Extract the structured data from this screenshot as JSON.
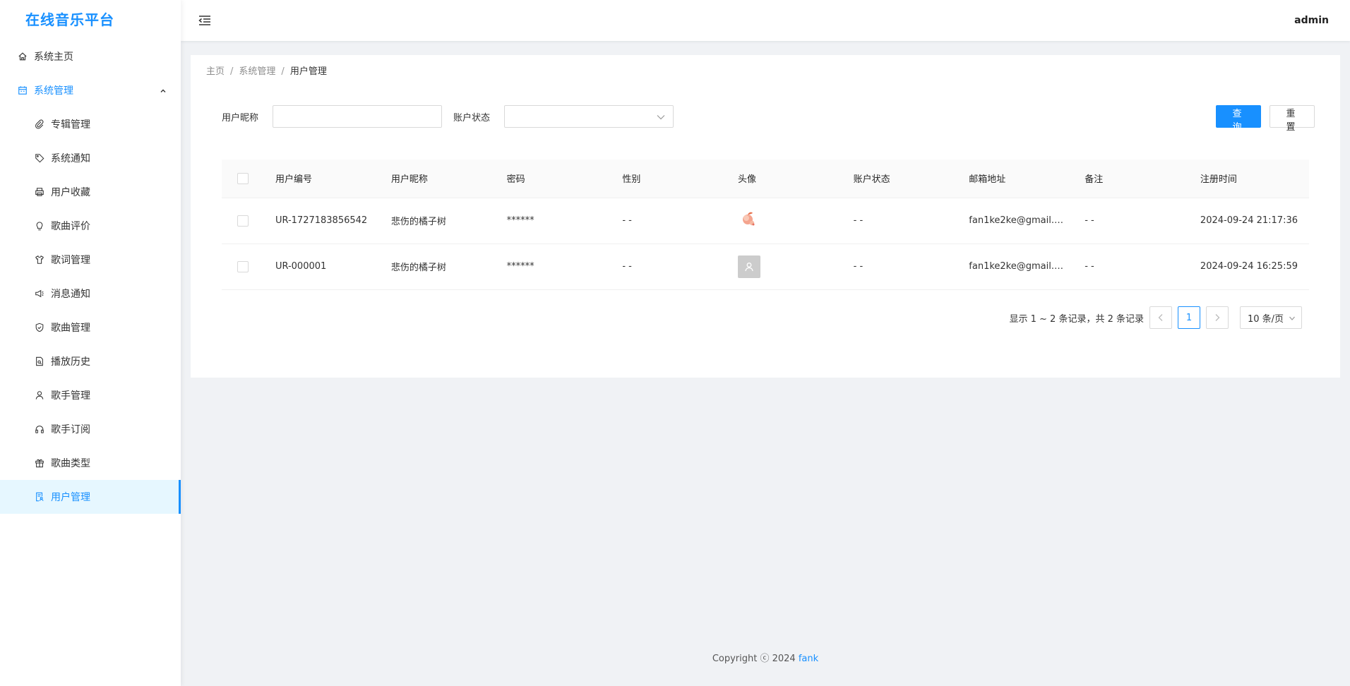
{
  "app": {
    "title": "在线音乐平台"
  },
  "header": {
    "user": "admin"
  },
  "sidebar": {
    "home": "系统主页",
    "system": "系统管理",
    "items": [
      {
        "label": "专辑管理",
        "icon": "paperclip-icon"
      },
      {
        "label": "系统通知",
        "icon": "tag-icon"
      },
      {
        "label": "用户收藏",
        "icon": "printer-icon"
      },
      {
        "label": "歌曲评价",
        "icon": "bulb-icon"
      },
      {
        "label": "歌词管理",
        "icon": "shirt-icon"
      },
      {
        "label": "消息通知",
        "icon": "sound-icon"
      },
      {
        "label": "歌曲管理",
        "icon": "safety-icon"
      },
      {
        "label": "播放历史",
        "icon": "file-search-icon"
      },
      {
        "label": "歌手管理",
        "icon": "user-icon"
      },
      {
        "label": "歌手订阅",
        "icon": "headphones-icon"
      },
      {
        "label": "歌曲类型",
        "icon": "gift-icon"
      },
      {
        "label": "用户管理",
        "icon": "file-user-icon",
        "active": true
      }
    ]
  },
  "breadcrumb": {
    "home": "主页",
    "section": "系统管理",
    "current": "用户管理"
  },
  "filters": {
    "nickname_label": "用户昵称",
    "nickname_value": "",
    "status_label": "账户状态",
    "status_value": ""
  },
  "buttons": {
    "query": "查询",
    "reset": "重置"
  },
  "table": {
    "columns": [
      "用户编号",
      "用户昵称",
      "密码",
      "性别",
      "头像",
      "账户状态",
      "邮箱地址",
      "备注",
      "注册时间"
    ],
    "rows": [
      {
        "id": "UR-1727183856542",
        "nickname": "悲伤的橘子树",
        "password": "******",
        "gender": "- -",
        "avatar": "peach",
        "status": "- -",
        "email": "fan1ke2ke@gmail.c...",
        "note": "- -",
        "registered": "2024-09-24 21:17:36"
      },
      {
        "id": "UR-000001",
        "nickname": "悲伤的橘子树",
        "password": "******",
        "gender": "- -",
        "avatar": "default",
        "status": "- -",
        "email": "fan1ke2ke@gmail.c...",
        "note": "- -",
        "registered": "2024-09-24 16:25:59"
      }
    ]
  },
  "pagination": {
    "summary": "显示 1 ~ 2 条记录，共 2 条记录",
    "current": "1",
    "page_size": "10 条/页"
  },
  "footer": {
    "prefix": "Copyright ⓒ 2024 ",
    "author": "fank"
  },
  "colors": {
    "accent": "#1890ff",
    "active_bg": "#e6f7ff"
  }
}
